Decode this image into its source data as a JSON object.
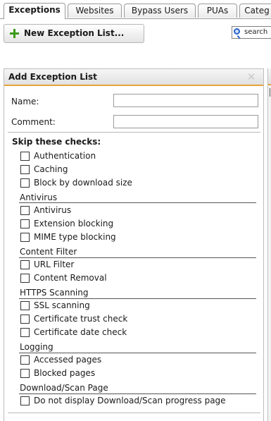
{
  "tabs": [
    {
      "label": "Exceptions",
      "active": true
    },
    {
      "label": "Websites",
      "active": false
    },
    {
      "label": "Bypass Users",
      "active": false
    },
    {
      "label": "PUAs",
      "active": false
    },
    {
      "label": "Categ",
      "active": false
    }
  ],
  "toolbar": {
    "new_button_label": "New Exception List...",
    "search_label": "search"
  },
  "panel": {
    "title": "Add Exception List",
    "name_label": "Name:",
    "name_value": "",
    "comment_label": "Comment:",
    "comment_value": "",
    "skip_title": "Skip these checks:",
    "general_checks": [
      {
        "label": "Authentication",
        "checked": false
      },
      {
        "label": "Caching",
        "checked": false
      },
      {
        "label": "Block by download size",
        "checked": false
      }
    ],
    "groups": [
      {
        "title": "Antivirus",
        "checks": [
          {
            "label": "Antivirus",
            "checked": false
          },
          {
            "label": "Extension blocking",
            "checked": false
          },
          {
            "label": "MIME type blocking",
            "checked": false
          }
        ]
      },
      {
        "title": "Content Filter",
        "checks": [
          {
            "label": "URL Filter",
            "checked": false
          },
          {
            "label": "Content Removal",
            "checked": false
          }
        ]
      },
      {
        "title": "HTTPS Scanning",
        "checks": [
          {
            "label": "SSL scanning",
            "checked": false
          },
          {
            "label": "Certificate trust check",
            "checked": false
          },
          {
            "label": "Certificate date check",
            "checked": false
          }
        ]
      },
      {
        "title": "Logging",
        "checks": [
          {
            "label": "Accessed pages",
            "checked": false
          },
          {
            "label": "Blocked pages",
            "checked": false
          }
        ]
      },
      {
        "title": "Download/Scan Page",
        "checks": [
          {
            "label": "Do not display Download/Scan progress page",
            "checked": false
          }
        ]
      }
    ]
  },
  "colors": {
    "accent": "#e8a33c",
    "plus": "#3d9a1c",
    "search": "#2a62c9"
  },
  "icons": [
    "plus-icon",
    "search-icon",
    "close-icon"
  ]
}
